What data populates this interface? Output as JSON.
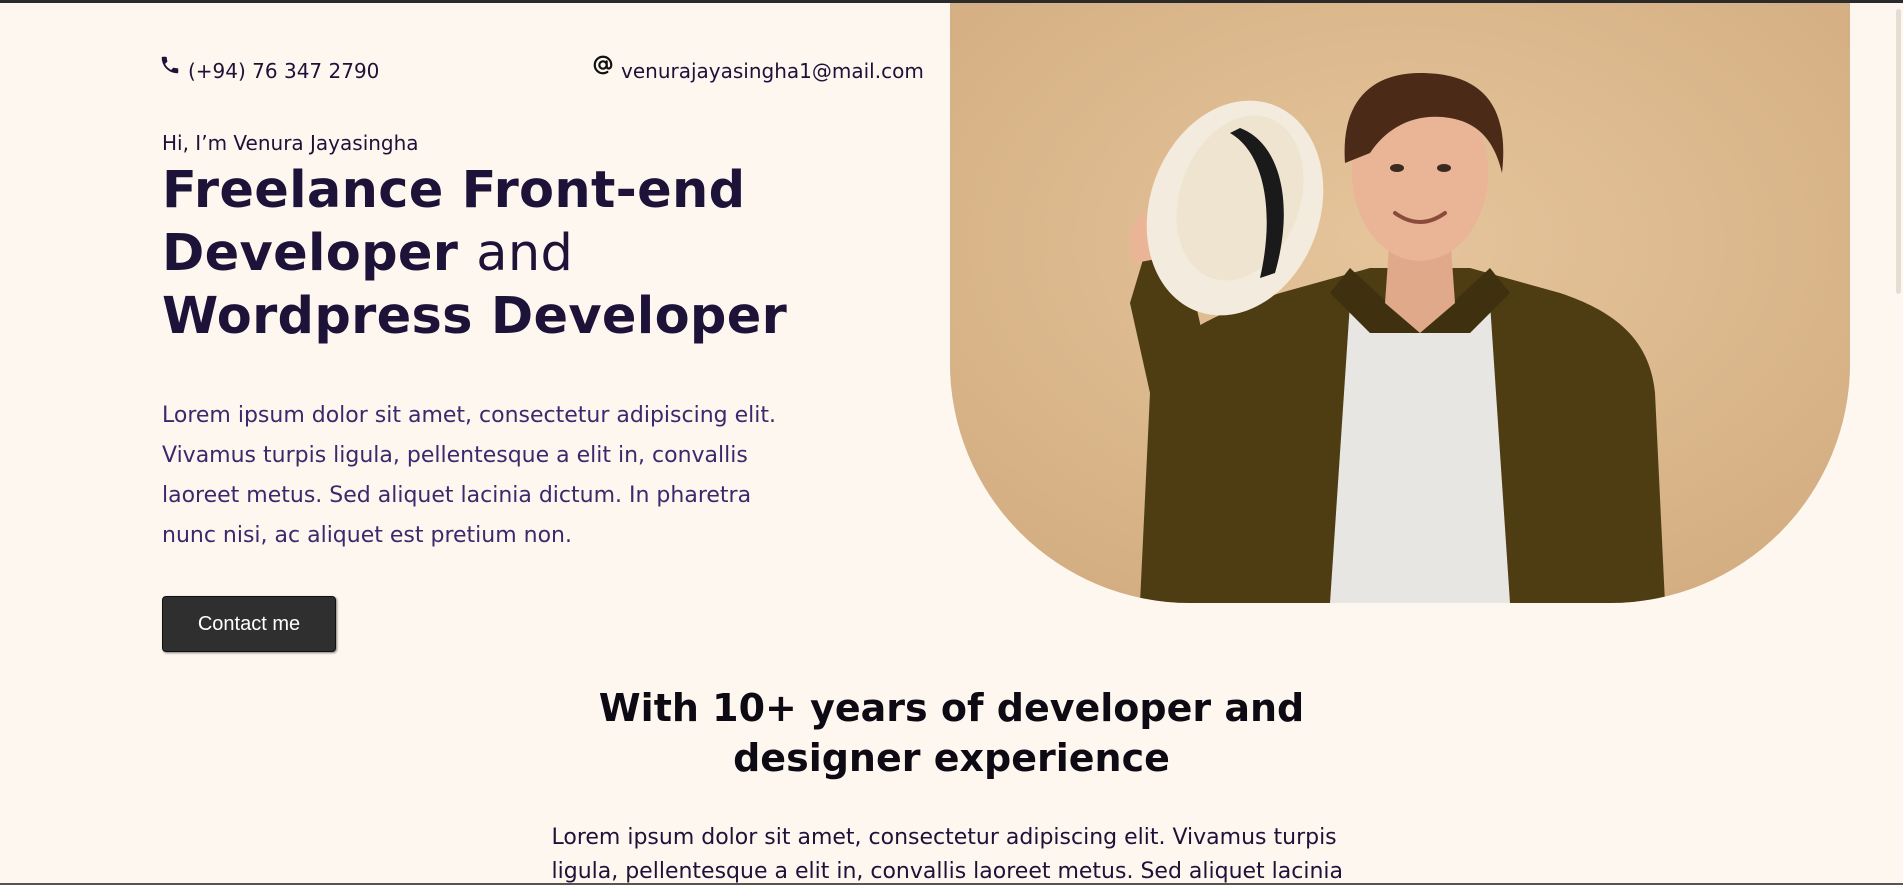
{
  "contact": {
    "phone": "(+94) 76 347 2790",
    "phone_icon": "phone-icon",
    "email": "venurajayasingha1@mail.com",
    "email_icon": "at-sign-icon"
  },
  "hero": {
    "intro": "Hi, I’m Venura Jayasingha",
    "title_line1": "Freelance Front-end",
    "title_line2_bold": "Developer",
    "title_line2_light": "and",
    "title_line3": "Wordpress Developer",
    "description": "Lorem ipsum dolor sit amet, consectetur adipiscing elit. Vivamus turpis ligula, pellentesque a elit in, convallis laoreet metus. Sed aliquet lacinia dictum. In pharetra nunc nisi, ac aliquet est pretium non.",
    "cta_label": "Contact me"
  },
  "experience": {
    "title": "With 10+ years of developer and designer experience",
    "description": "Lorem ipsum dolor sit amet, consectetur adipiscing elit. Vivamus turpis ligula, pellentesque a elit in, convallis laoreet metus. Sed aliquet lacinia"
  },
  "colors": {
    "background": "#fdf7f0",
    "heading": "#1d1238",
    "body_text": "#3a2a6b",
    "button": "#2f2f2f",
    "photo_backdrop": "#dbb78d"
  }
}
